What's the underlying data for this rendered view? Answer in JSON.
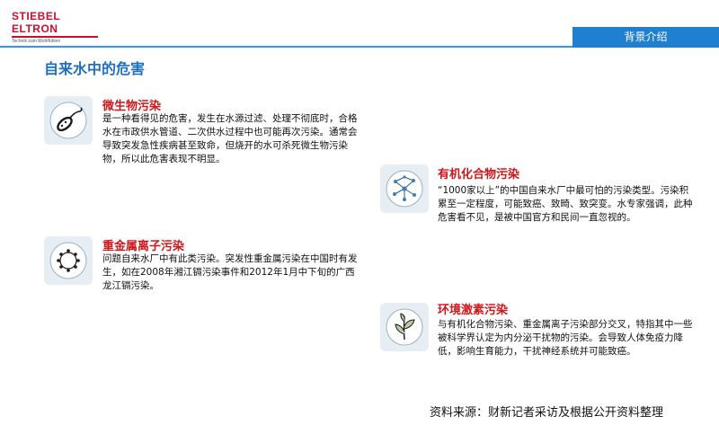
{
  "brand": {
    "name": "STIEBEL ELTRON",
    "tagline": "Technik zum Wohlfühlen"
  },
  "header": {
    "section_tab": "背景介绍",
    "title": "自来水中的危害"
  },
  "items": [
    {
      "heading": "微生物污染",
      "icon": "microbe-icon",
      "body": "是一种看得见的危害，发生在水源过滤、处理不彻底时，合格水在市政供水管道、二次供水过程中也可能再次污染。通常会导致突发急性疾病甚至致命，但烧开的水可杀死微生物污染物，所以此危害表现不明显。"
    },
    {
      "heading": "有机化合物污染",
      "icon": "molecule-network-icon",
      "body": "“1000家以上”的中国自来水厂中最可怕的污染类型。污染积累至一定程度，可能致癌、致畸、致突变。水专家强调，此种危害看不见，是被中国官方和民间一直忽视的。"
    },
    {
      "heading": "重金属离子污染",
      "icon": "metal-ion-icon",
      "body": "问题自来水厂中有此类污染。突发性重金属污染在中国时有发生，如在2008年湘江镉污染事件和2012年1月中下旬的广西龙江镉污染。"
    },
    {
      "heading": "环境激素污染",
      "icon": "hormone-leaf-icon",
      "body": "与有机化合物污染、重金属离子污染部分交叉，特指其中一些被科学界认定为内分泌干扰物的污染。会导致人体免疫力降低，影响生育能力，干扰神经系统并可能致癌。"
    }
  ],
  "footer": {
    "source": "资料来源：财新记者采访及根据公开资料整理"
  },
  "colors": {
    "accent_blue": "#1f7fd1",
    "heading_red": "#d0161a",
    "title_blue": "#1f6fbf",
    "brand_red": "#c8102e"
  }
}
